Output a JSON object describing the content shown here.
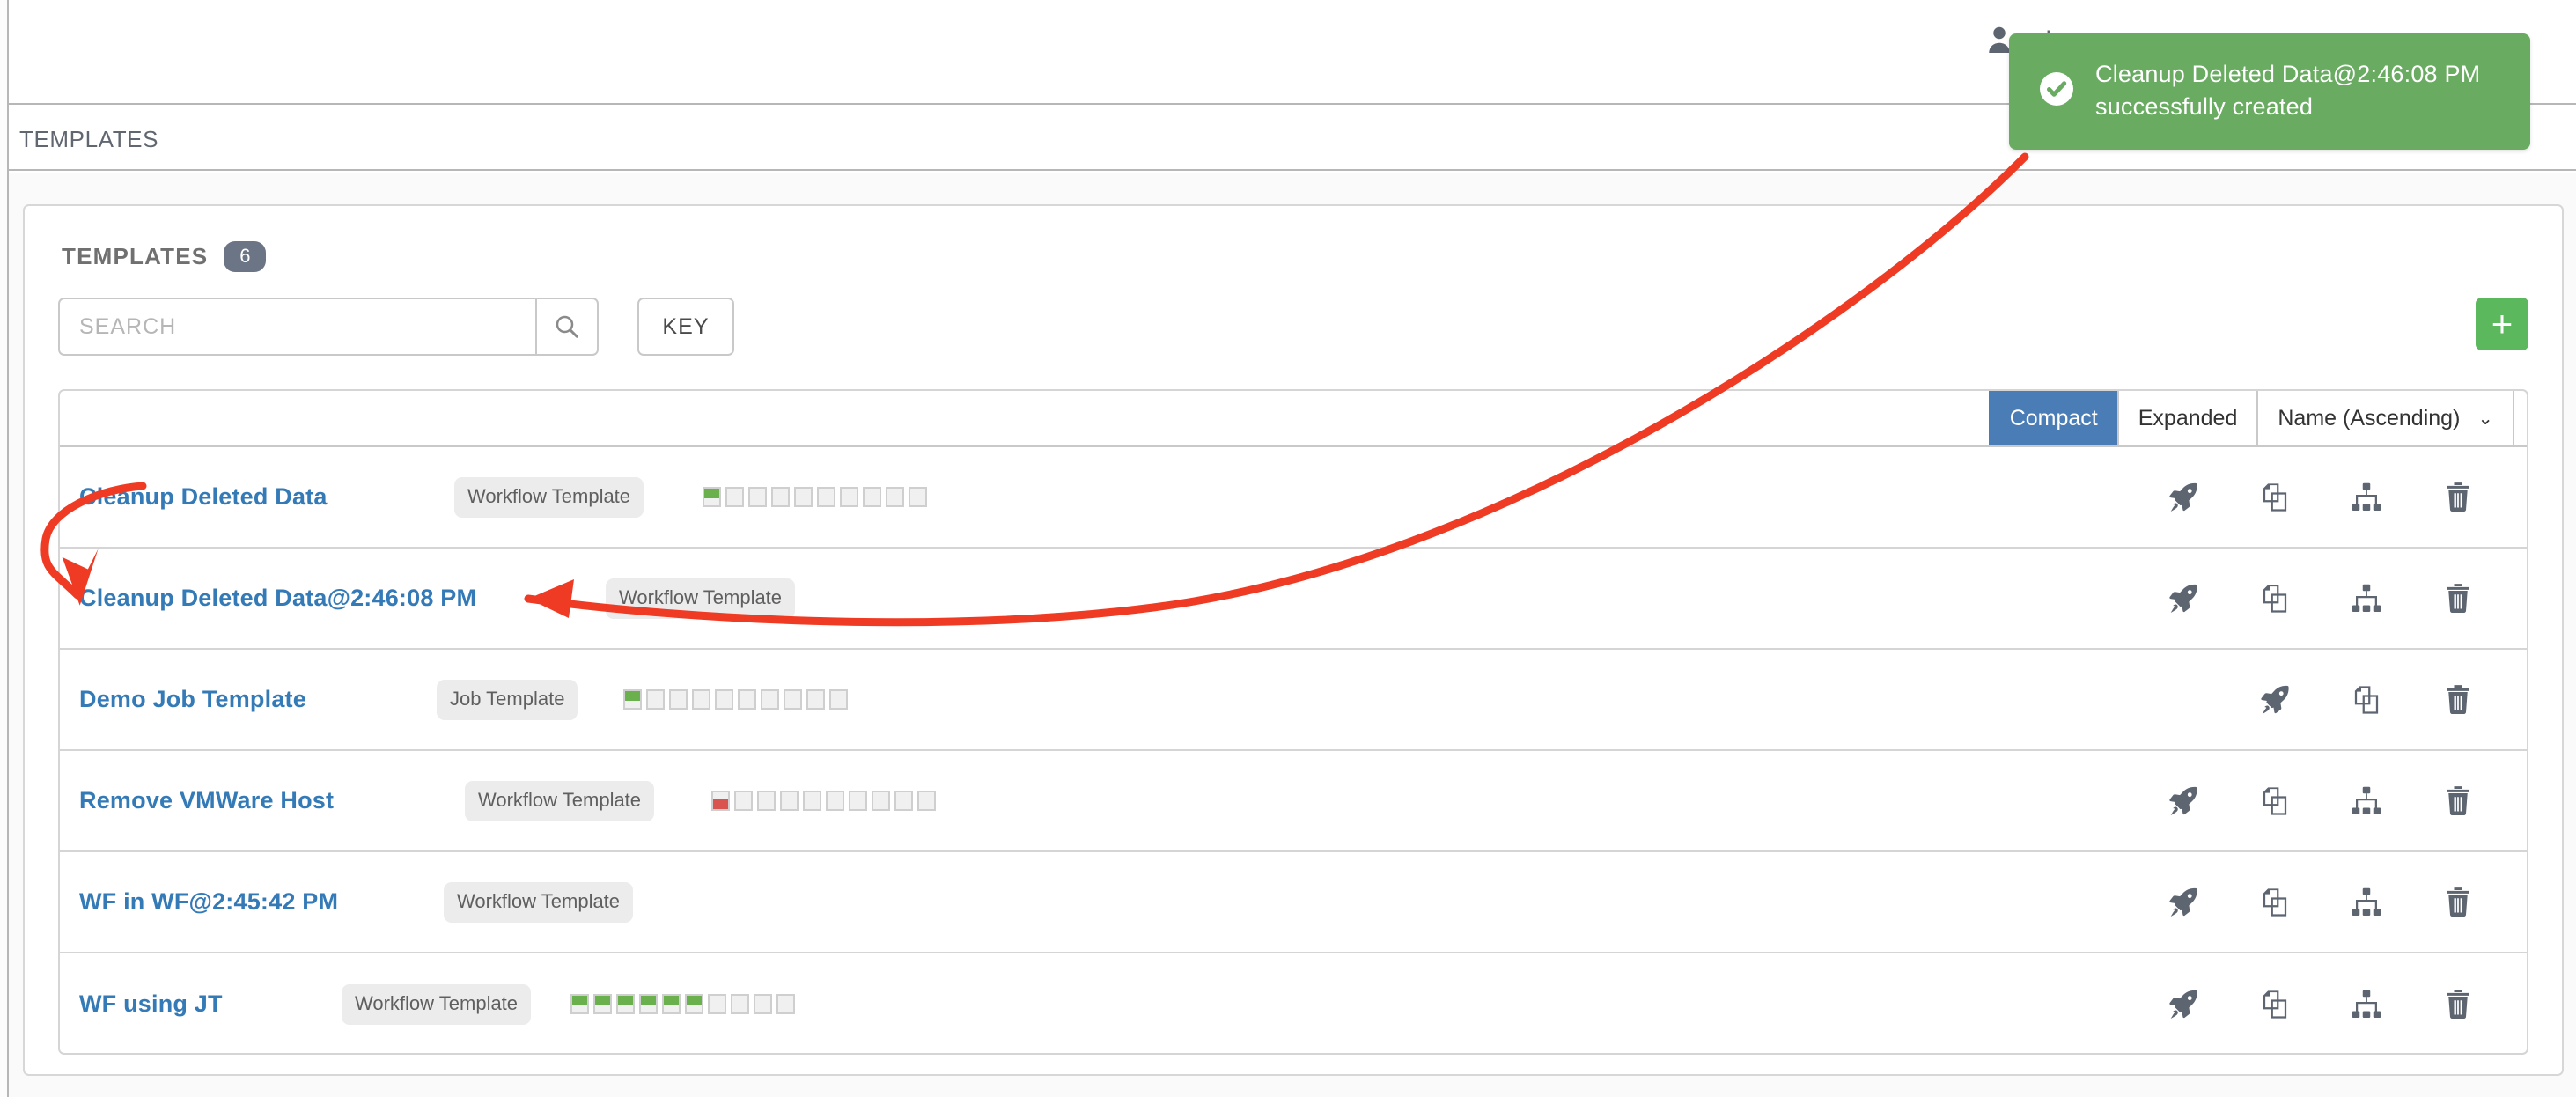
{
  "topbar": {
    "user_label": "ad",
    "user_icon": "user-icon"
  },
  "breadcrumb": {
    "text": "TEMPLATES"
  },
  "panel": {
    "title": "TEMPLATES",
    "count": "6"
  },
  "search": {
    "placeholder": "SEARCH",
    "value": "",
    "search_icon": "search-icon",
    "key_label": "KEY",
    "add_label": "+"
  },
  "toolbar": {
    "compact_label": "Compact",
    "expanded_label": "Expanded",
    "sort_label": "Name (Ascending)",
    "chevron": "⌄"
  },
  "toast": {
    "message": "Cleanup Deleted Data@2:46:08 PM successfully created",
    "icon": "check-circle-icon",
    "background": "#6aab62"
  },
  "colors": {
    "link": "#337ab7",
    "accent_blue": "#4a7cb5",
    "success_green": "#6aab62",
    "status_green": "#6ab04c",
    "status_red": "#d9534f",
    "annotation_red": "#ef3b24"
  },
  "rows": [
    {
      "name": "Cleanup Deleted Data",
      "badge": "Workflow Template",
      "statuses": [
        "success",
        "empty",
        "empty",
        "empty",
        "empty",
        "empty",
        "empty",
        "empty",
        "empty",
        "empty"
      ],
      "actions": [
        "rocket-icon",
        "copy-icon",
        "sitemap-icon",
        "trash-icon"
      ]
    },
    {
      "name": "Cleanup Deleted Data@2:46:08 PM",
      "badge": "Workflow Template",
      "statuses": [],
      "actions": [
        "rocket-icon",
        "copy-icon",
        "sitemap-icon",
        "trash-icon"
      ]
    },
    {
      "name": "Demo Job Template",
      "badge": "Job Template",
      "statuses": [
        "success",
        "empty",
        "empty",
        "empty",
        "empty",
        "empty",
        "empty",
        "empty",
        "empty",
        "empty"
      ],
      "actions": [
        "rocket-icon",
        "copy-icon",
        "trash-icon"
      ]
    },
    {
      "name": "Remove VMWare Host",
      "badge": "Workflow Template",
      "statuses": [
        "failed",
        "empty",
        "empty",
        "empty",
        "empty",
        "empty",
        "empty",
        "empty",
        "empty",
        "empty"
      ],
      "actions": [
        "rocket-icon",
        "copy-icon",
        "sitemap-icon",
        "trash-icon"
      ]
    },
    {
      "name": "WF in WF@2:45:42 PM",
      "badge": "Workflow Template",
      "statuses": [],
      "actions": [
        "rocket-icon",
        "copy-icon",
        "sitemap-icon",
        "trash-icon"
      ]
    },
    {
      "name": "WF using JT",
      "badge": "Workflow Template",
      "statuses": [
        "success",
        "success",
        "success",
        "success",
        "success",
        "success",
        "empty",
        "empty",
        "empty",
        "empty"
      ],
      "actions": [
        "rocket-icon",
        "copy-icon",
        "sitemap-icon",
        "trash-icon"
      ]
    }
  ]
}
